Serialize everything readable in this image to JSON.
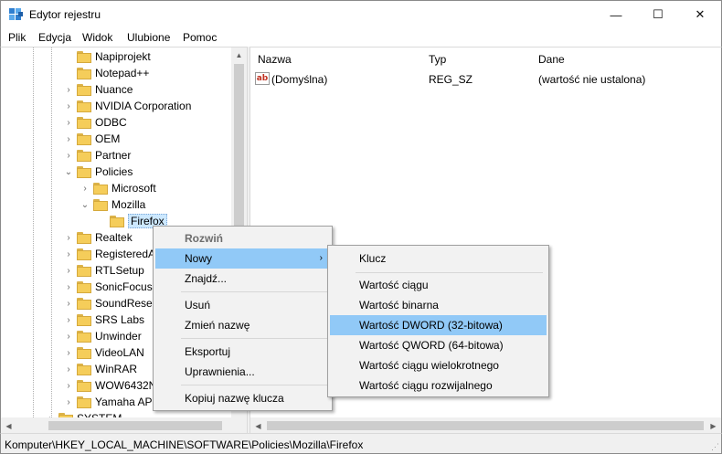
{
  "window": {
    "title": "Edytor rejestru",
    "min_glyph": "—",
    "max_glyph": "☐",
    "close_glyph": "✕",
    "icon": "registry-editor-icon"
  },
  "menubar": [
    "Plik",
    "Edycja",
    "Widok",
    "Ulubione",
    "Pomoc"
  ],
  "tree": {
    "items": [
      {
        "label": "Napiprojekt",
        "expander": ""
      },
      {
        "label": "Notepad++",
        "expander": ""
      },
      {
        "label": "Nuance",
        "expander": "›"
      },
      {
        "label": "NVIDIA Corporation",
        "expander": "›"
      },
      {
        "label": "ODBC",
        "expander": "›"
      },
      {
        "label": "OEM",
        "expander": "›"
      },
      {
        "label": "Partner",
        "expander": "›"
      },
      {
        "label": "Policies",
        "expander": "⌄"
      },
      {
        "label": "Microsoft",
        "expander": "›"
      },
      {
        "label": "Mozilla",
        "expander": "⌄"
      },
      {
        "label": "Firefox",
        "expander": ""
      },
      {
        "label": "Realtek",
        "expander": "›"
      },
      {
        "label": "RegisteredA",
        "expander": "›"
      },
      {
        "label": "RTLSetup",
        "expander": "›"
      },
      {
        "label": "SonicFocus",
        "expander": "›"
      },
      {
        "label": "SoundResea",
        "expander": "›"
      },
      {
        "label": "SRS Labs",
        "expander": "›"
      },
      {
        "label": "Unwinder",
        "expander": "›"
      },
      {
        "label": "VideoLAN",
        "expander": "›"
      },
      {
        "label": "WinRAR",
        "expander": "›"
      },
      {
        "label": "WOW6432N",
        "expander": "›"
      },
      {
        "label": "Yamaha APO",
        "expander": "›"
      },
      {
        "label": "SYSTEM",
        "expander": "›"
      }
    ]
  },
  "list": {
    "columns": [
      "Nazwa",
      "Typ",
      "Dane"
    ],
    "rows": [
      {
        "name": "(Domyślna)",
        "type": "REG_SZ",
        "data": "(wartość nie ustalona)",
        "icon": "string-value-icon"
      }
    ]
  },
  "context_menu": {
    "items": [
      "Rozwiń",
      "Nowy",
      "Znajdź...",
      "Usuń",
      "Zmień nazwę",
      "Eksportuj",
      "Uprawnienia...",
      "Kopiuj nazwę klucza"
    ],
    "submenu_arrow": "›"
  },
  "submenu": {
    "items": [
      "Klucz",
      "Wartość ciągu",
      "Wartość binarna",
      "Wartość DWORD (32-bitowa)",
      "Wartość QWORD (64-bitowa)",
      "Wartość ciągu wielokrotnego",
      "Wartość ciągu rozwijalnego"
    ]
  },
  "status": {
    "path": "Komputer\\HKEY_LOCAL_MACHINE\\SOFTWARE\\Policies\\Mozilla\\Firefox"
  },
  "colors": {
    "highlight": "#91c9f7",
    "selection": "#cce8ff",
    "folder": "#f5cd5a"
  }
}
